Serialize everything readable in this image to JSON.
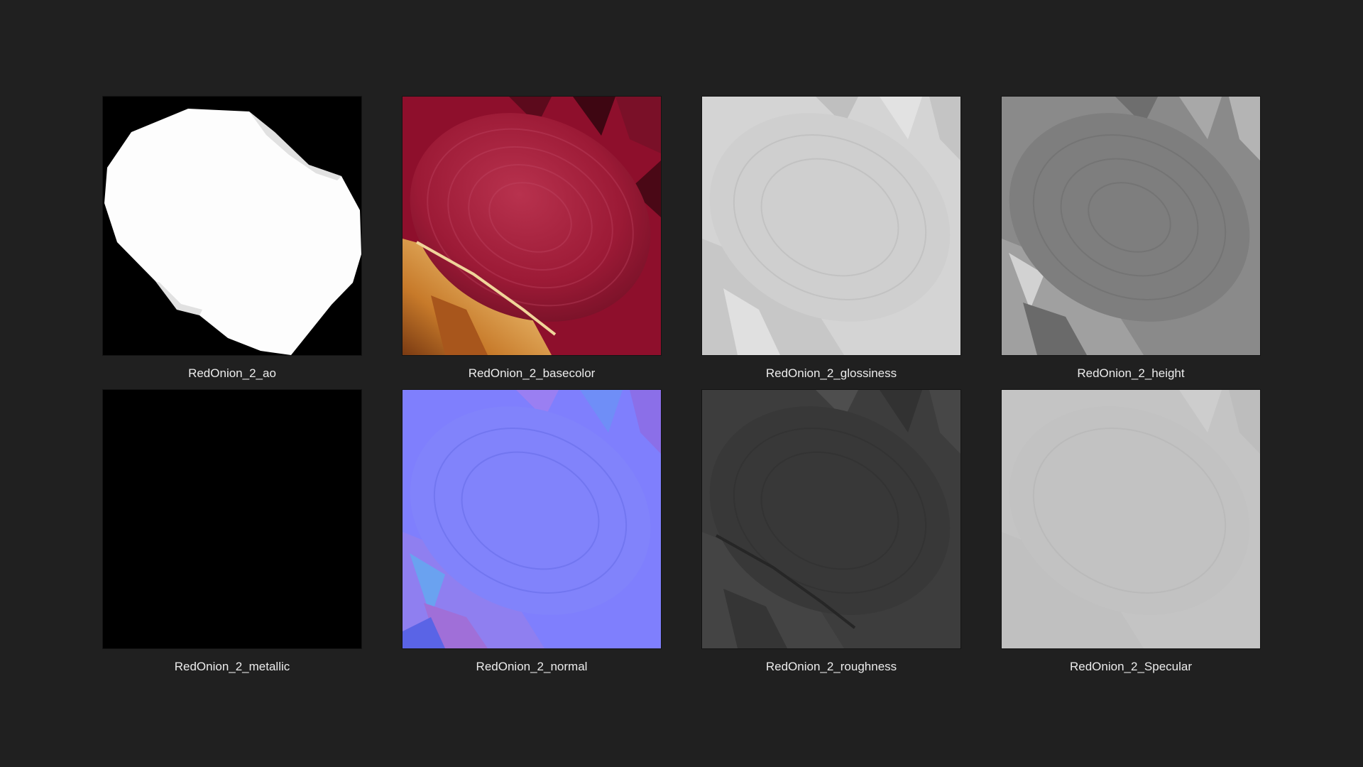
{
  "textures": [
    {
      "label": "RedOnion_2_ao"
    },
    {
      "label": "RedOnion_2_basecolor"
    },
    {
      "label": "RedOnion_2_glossiness"
    },
    {
      "label": "RedOnion_2_height"
    },
    {
      "label": "RedOnion_2_metallic"
    },
    {
      "label": "RedOnion_2_normal"
    },
    {
      "label": "RedOnion_2_roughness"
    },
    {
      "label": "RedOnion_2_Specular"
    }
  ]
}
